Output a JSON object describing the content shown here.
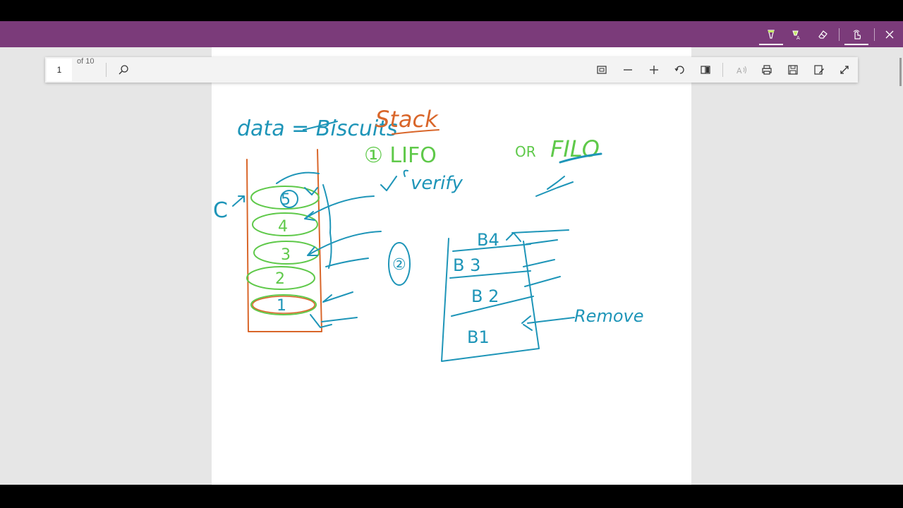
{
  "app": {
    "titlebar_tools": [
      "highlight-icon",
      "read-aloud-icon",
      "eraser-icon",
      "touch-write-icon",
      "close-icon"
    ],
    "accent_color": "#7b3b7a"
  },
  "toolbar": {
    "page_number": "1",
    "page_count": "of 10",
    "tools": [
      "search-icon",
      "fit-page-icon",
      "zoom-out-icon",
      "zoom-in-icon",
      "rotate-icon",
      "page-view-icon",
      "read-aloud-icon",
      "print-icon",
      "save-icon",
      "save-as-icon",
      "fullscreen-icon"
    ]
  },
  "notes": {
    "title": "data = Biscuits",
    "heading": "Stack",
    "point1": "① LIFO",
    "or": "OR",
    "filo": "FILO",
    "verify": "verify",
    "c_label": "C",
    "stack_items": [
      "5",
      "4",
      "3",
      "2",
      "1"
    ],
    "point2": "②",
    "b4": "B4",
    "b3": "B 3",
    "b2": "B 2",
    "b1": "B1",
    "remove": "Remove"
  },
  "colors": {
    "ink_blue": "#1e95b8",
    "ink_green": "#5fc94a",
    "ink_orange": "#d9662a"
  }
}
